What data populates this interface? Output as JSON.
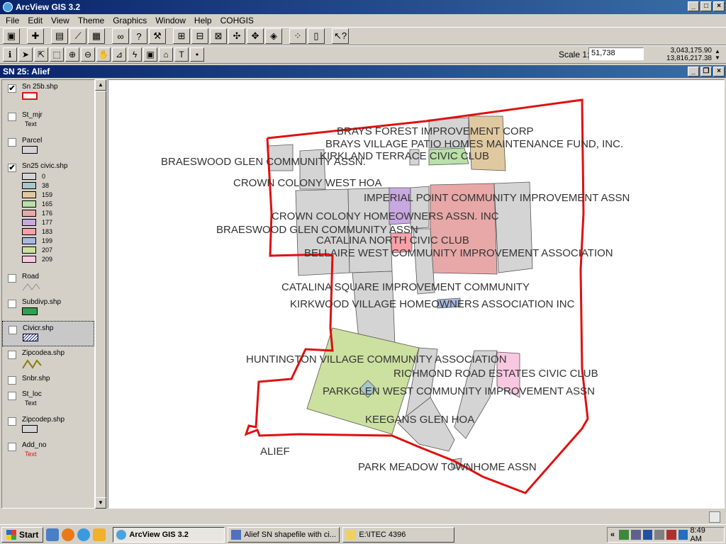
{
  "app": {
    "title": "ArcView GIS 3.2"
  },
  "menus": [
    "File",
    "Edit",
    "View",
    "Theme",
    "Graphics",
    "Window",
    "Help",
    "COHGIS"
  ],
  "scale": {
    "label": "Scale 1:",
    "value": "51,738"
  },
  "coords": {
    "x": "3,043,175.90",
    "y": "13,816,217.38"
  },
  "view": {
    "title": "SN 25: Alief"
  },
  "legend": {
    "themes": [
      {
        "name": "Sn 25b.shp",
        "checked": true
      },
      {
        "name": "St_mjr",
        "checked": false,
        "symbol": "Text"
      },
      {
        "name": "Parcel",
        "checked": false
      },
      {
        "name": "Sn25 civic.shp",
        "checked": true,
        "classes": [
          "0",
          "38",
          "159",
          "165",
          "176",
          "177",
          "183",
          "199",
          "207",
          "209"
        ]
      },
      {
        "name": "Road",
        "checked": false
      },
      {
        "name": "Subdivp.shp",
        "checked": false
      },
      {
        "name": "Civicr.shp",
        "checked": false
      },
      {
        "name": "Zipcodea.shp",
        "checked": false
      },
      {
        "name": "Snbr.shp",
        "checked": false
      },
      {
        "name": "St_loc",
        "checked": false,
        "symbol": "Text"
      },
      {
        "name": "Zipcodep.shp",
        "checked": false
      },
      {
        "name": "Add_no",
        "checked": false,
        "symbol": "Text"
      }
    ]
  },
  "colors": {
    "boundary": "#e01010",
    "class_0": "#d4d4d4",
    "class_38": "#a8c8c8",
    "class_159": "#e0c8a0",
    "class_165": "#b8e0a8",
    "class_176": "#e8a8a8",
    "class_177": "#c8a8e0",
    "class_183": "#f8a0a8",
    "class_199": "#a8b8e0",
    "class_207": "#cce0a0",
    "class_209": "#f8c8e0",
    "subdiv": "#30a050"
  },
  "map": {
    "labels": [
      "BRAYS FOREST IMPROVEMENT CORP",
      "BRAYS VILLAGE PATIO HOMES MAINTENANCE FUND, INC.",
      "KIRKLAND TERRACE CIVIC CLUB",
      "BRAESWOOD GLEN COMMUNITY ASSN.",
      "CROWN COLONY WEST HOA",
      "IMPERIAL POINT COMMUNITY IMPROVEMENT ASSN",
      "CROWN COLONY HOMEOWNERS ASSN. INC",
      "BRAESWOOD GLEN COMMUNITY ASSN",
      "CATALINA NORTH CIVIC CLUB",
      "BELLAIRE WEST COMMUNITY IMPROVEMENT ASSOCIATION",
      "CATALINA SQUARE IMPROVEMENT COMMUNITY",
      "KIRKWOOD VILLAGE HOMEOWNERS ASSOCIATION INC",
      "HUNTINGTON VILLAGE COMMUNITY ASSOCIATION",
      "RICHMOND ROAD ESTATES CIVIC CLUB",
      "PARKGLEN WEST COMMUNITY IMPROVEMENT ASSN",
      "KEEGANS GLEN HOA",
      "ALIEF",
      "PARK MEADOW TOWNHOME ASSN"
    ]
  },
  "taskbar": {
    "start": "Start",
    "tasks": [
      "ArcView GIS 3.2",
      "Alief SN shapefile with ci...",
      "E:\\ITEC 4396"
    ],
    "tray_chevron": "«",
    "clock": "8:49 AM"
  }
}
